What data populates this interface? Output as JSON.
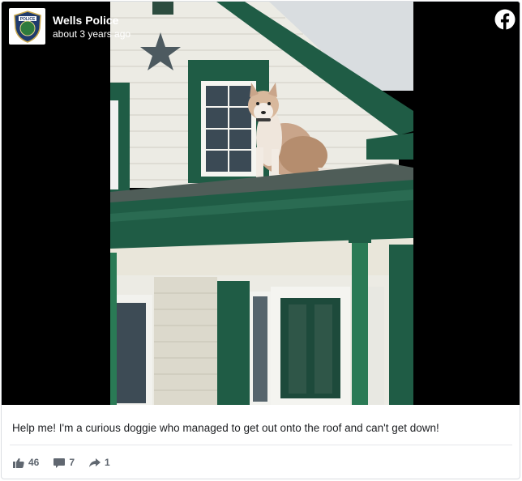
{
  "post": {
    "page_name": "Wells Police",
    "timestamp": "about 3 years ago",
    "caption": "Help me! I'm a curious doggie who managed to get out onto the roof and can't get down!",
    "photo_description": "Photo of a husky dog sitting on the porch roof of a white house with green trim and a star decoration",
    "logo_text": "POLICE"
  },
  "reactions": {
    "likes": "46",
    "comments": "7",
    "shares": "1"
  },
  "icons": {
    "like": "thumbs-up-icon",
    "comment": "comment-icon",
    "share": "share-icon",
    "brand": "facebook-icon"
  },
  "colors": {
    "facebook_white": "#ffffff",
    "meta_gray": "#606770",
    "text": "#1c1e21",
    "house_green": "#1f5c45",
    "siding": "#ecebe4"
  }
}
